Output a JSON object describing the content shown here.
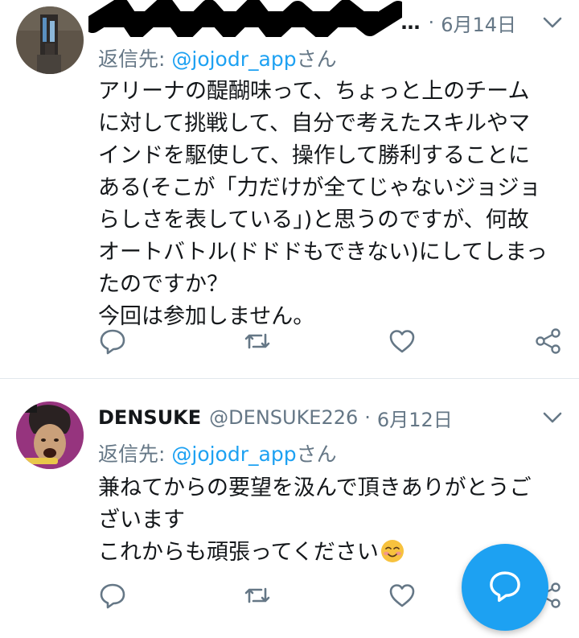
{
  "colors": {
    "accent": "#1da1f2",
    "secondary_text": "#657786",
    "primary_text": "#14171a",
    "divider": "#e1e8ed"
  },
  "tweets": [
    {
      "date_prefix": "…",
      "date": "6月14日",
      "reply_prefix": "返信先: ",
      "reply_mention": "@jojodr_app",
      "reply_suffix": "さん",
      "lines": [
        "アリーナの醍醐味って、ちょっと上のチーム",
        "に対して挑戦して、自分で考えたスキルやマ",
        "インドを駆使して、操作して勝利することに",
        "ある(そこが「力だけが全てじゃないジョジョ",
        "らしさを表している」)と思うのですが、何故",
        "オートバトル(ドドドもできない)にしてしまっ",
        "たのですか？",
        "今回は参加しません。"
      ]
    },
    {
      "name": "DENSUKE",
      "handle": "@DENSUKE226",
      "date": "6月12日",
      "reply_prefix": "返信先: ",
      "reply_mention": "@jojodr_app",
      "reply_suffix": "さん",
      "lines": [
        "兼ねてからの要望を汲んで頂きありがとうご",
        "ざいます",
        "これからも頑張ってください"
      ],
      "emoji": "smiling-face-with-blush-emoji"
    }
  ],
  "icons": {
    "reply": "reply-icon",
    "retweet": "retweet-icon",
    "like": "like-icon",
    "share": "share-icon",
    "menu": "chevron-down-icon",
    "compose": "compose-reply-icon"
  }
}
